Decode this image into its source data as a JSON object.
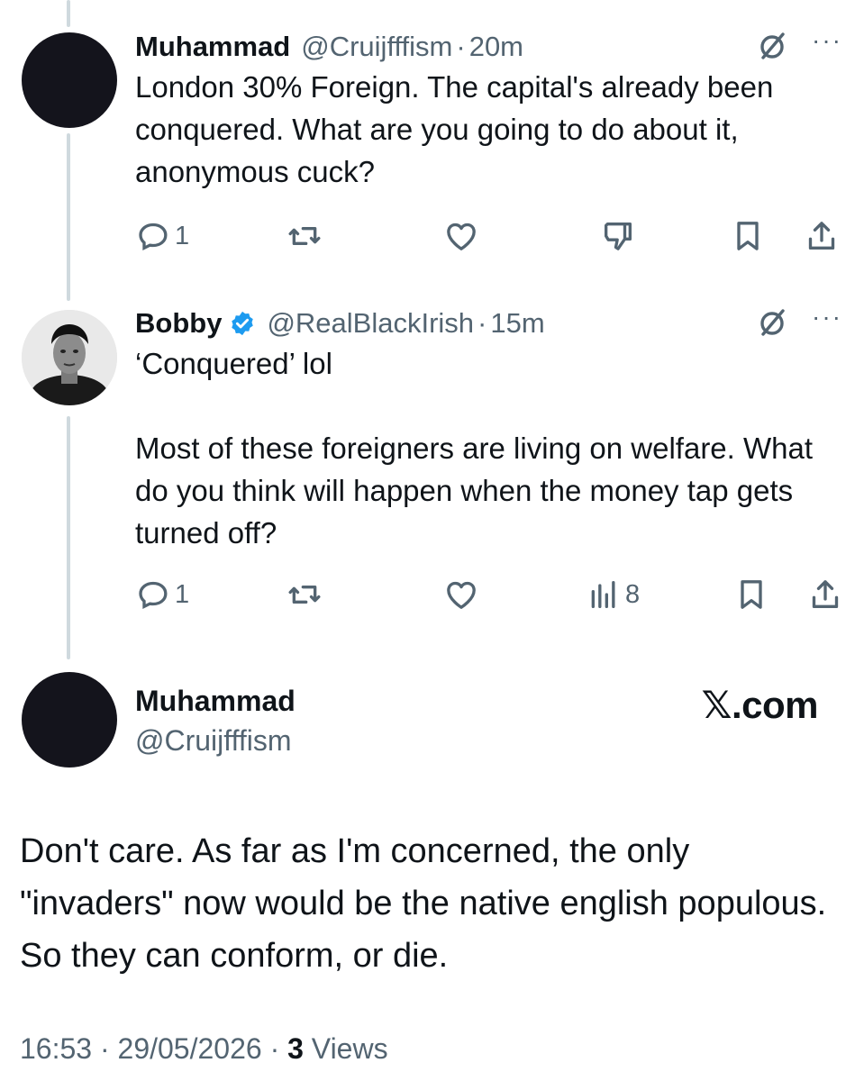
{
  "tweet1": {
    "name": "Muhammad",
    "handle": "@Cruijfffism",
    "dot": "·",
    "time": "20m",
    "text": "London 30% Foreign. The capital's already been conquered. What are you going to do about it, anonymous cuck?",
    "replies": "1",
    "more": "···"
  },
  "tweet2": {
    "name": "Bobby",
    "handle": "@RealBlackIrish",
    "dot": "·",
    "time": "15m",
    "text": "‘Conquered’ lol\n\nMost of these foreigners are living on welfare. What do you think will happen when the money tap gets turned off?",
    "replies": "1",
    "views": "8",
    "more": "···"
  },
  "main_tweet": {
    "name": "Muhammad",
    "handle": "@Cruijfffism",
    "watermark": "𝕏.com",
    "text": "Don't care. As far as I'm concerned, the only \"invaders\" now would be the native english populous. So they can conform, or die.",
    "timestamp": "16:53",
    "dot1": "·",
    "date": "29/05/2026",
    "dot2": "·",
    "views_count": "3",
    "views_label": "Views"
  },
  "colors": {
    "text": "#0f1419",
    "secondary": "#536471",
    "verified": "#1d9bf0",
    "thread_line": "#cfd9de",
    "avatar_dark": "#14141c"
  }
}
